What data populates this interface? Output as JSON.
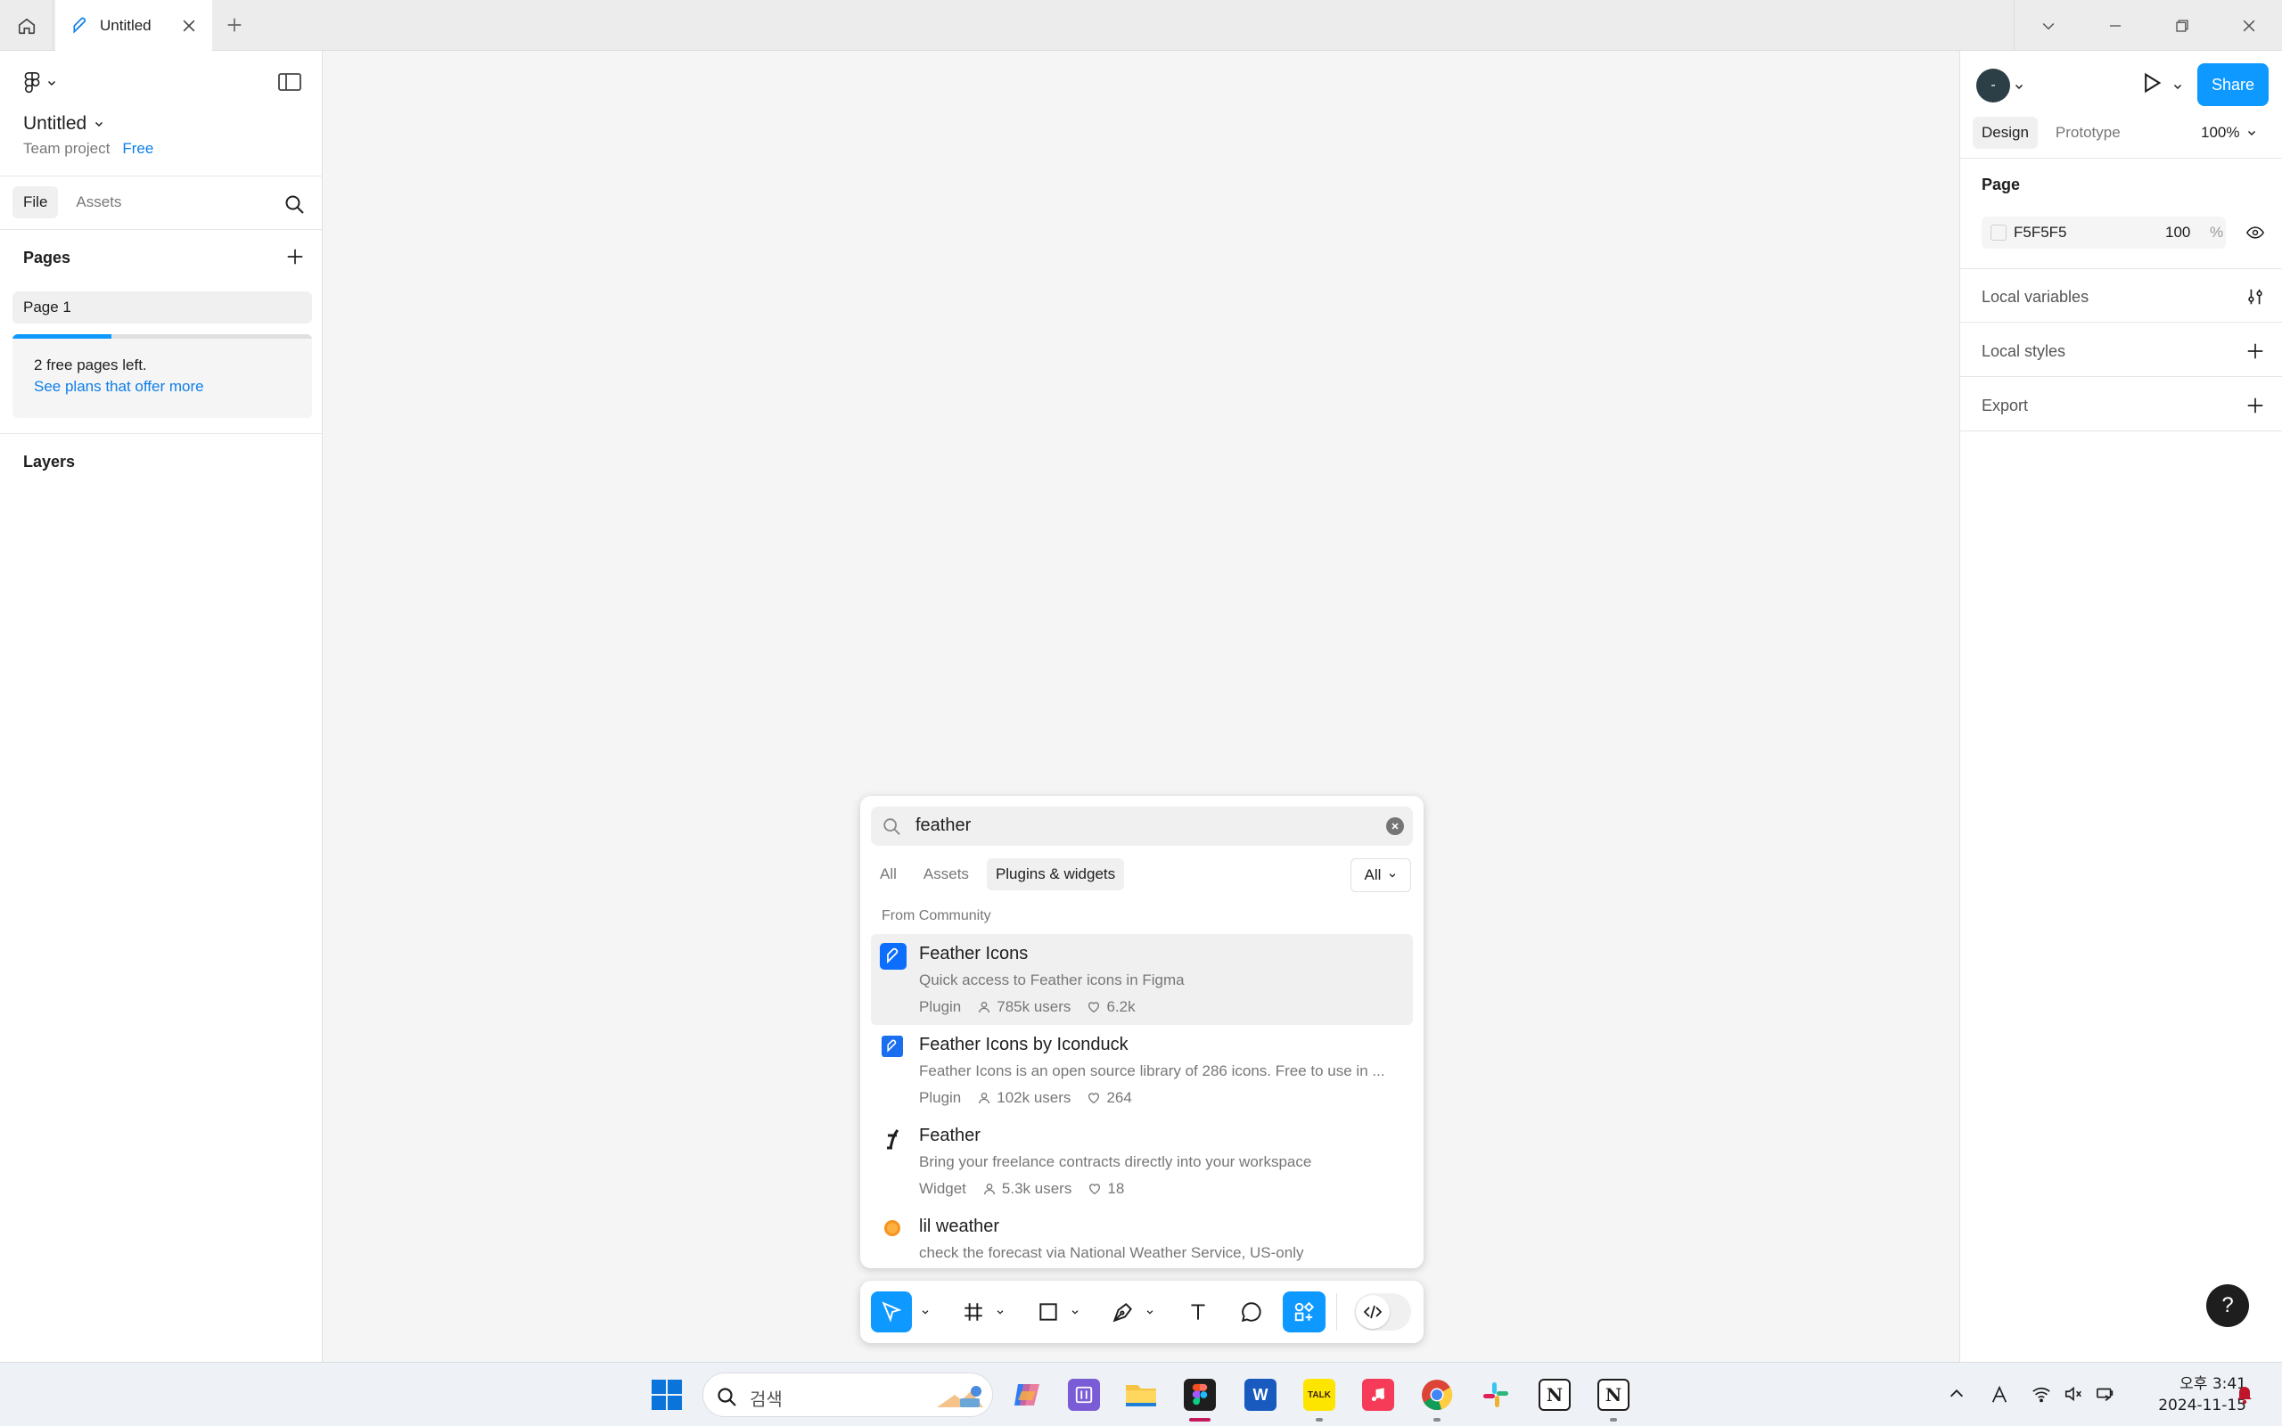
{
  "titlebar": {
    "tab_title": "Untitled"
  },
  "left_panel": {
    "file_name": "Untitled",
    "team": "Team project",
    "plan": "Free",
    "tabs": [
      "File",
      "Assets"
    ],
    "pages_heading": "Pages",
    "pages": [
      "Page 1"
    ],
    "upsell": {
      "text": "2 free pages left.",
      "link": "See plans that offer more",
      "progress": 0.33
    },
    "layers_heading": "Layers"
  },
  "right_panel": {
    "avatar_initial": "-",
    "share_label": "Share",
    "tabs": [
      "Design",
      "Prototype"
    ],
    "zoom": "100%",
    "page_heading": "Page",
    "page_color": "F5F5F5",
    "page_opacity": "100",
    "opacity_unit": "%",
    "rows": [
      "Local variables",
      "Local styles",
      "Export"
    ],
    "help": "?"
  },
  "search_popup": {
    "query": "feather",
    "filters": [
      "All",
      "Assets",
      "Plugins & widgets"
    ],
    "scope": "All",
    "section": "From Community",
    "results": [
      {
        "name": "Feather Icons",
        "description": "Quick access to Feather icons in Figma",
        "type": "Plugin",
        "users": "785k users",
        "likes": "6.2k"
      },
      {
        "name": "Feather Icons by Iconduck",
        "description": "Feather Icons is an open source library of 286 icons. Free to use in ...",
        "type": "Plugin",
        "users": "102k users",
        "likes": "264"
      },
      {
        "name": "Feather",
        "description": "Bring your freelance contracts directly into your workspace",
        "type": "Widget",
        "users": "5.3k users",
        "likes": "18"
      },
      {
        "name": "lil weather",
        "description": "check the forecast via National Weather Service, US-only"
      }
    ]
  },
  "taskbar": {
    "search_placeholder": "검색",
    "time": "오후 3:41",
    "date": "2024-11-15",
    "word_letter": "W",
    "talk_label": "TALK",
    "notion_letter": "N"
  },
  "colors": {
    "accent": "#0d99ff",
    "link": "#0d7ee8",
    "canvas": "#f5f5f5"
  }
}
